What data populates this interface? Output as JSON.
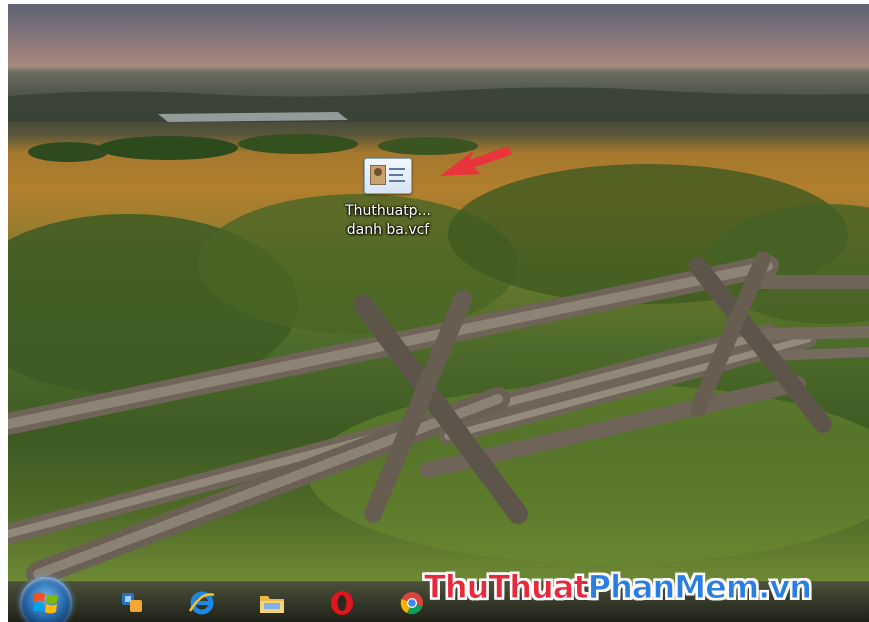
{
  "desktop": {
    "icon": {
      "name": "vcf-file-icon",
      "label_line1": "Thuthuatp...",
      "label_line2": "danh ba.vcf"
    },
    "pointer_arrow_color": "#e8343a"
  },
  "taskbar": {
    "start_button": "windows-start-orb",
    "pinned": [
      {
        "name": "windows-explorer-icon"
      },
      {
        "name": "internet-explorer-icon"
      },
      {
        "name": "file-folder-icon"
      },
      {
        "name": "opera-icon"
      },
      {
        "name": "chrome-icon"
      }
    ],
    "watermark": {
      "part1": "ThuThuat",
      "part2": "PhanMem",
      "part3": ".vn"
    }
  },
  "colors": {
    "watermark_red": "#e8283b",
    "watermark_blue": "#2a7de1"
  }
}
